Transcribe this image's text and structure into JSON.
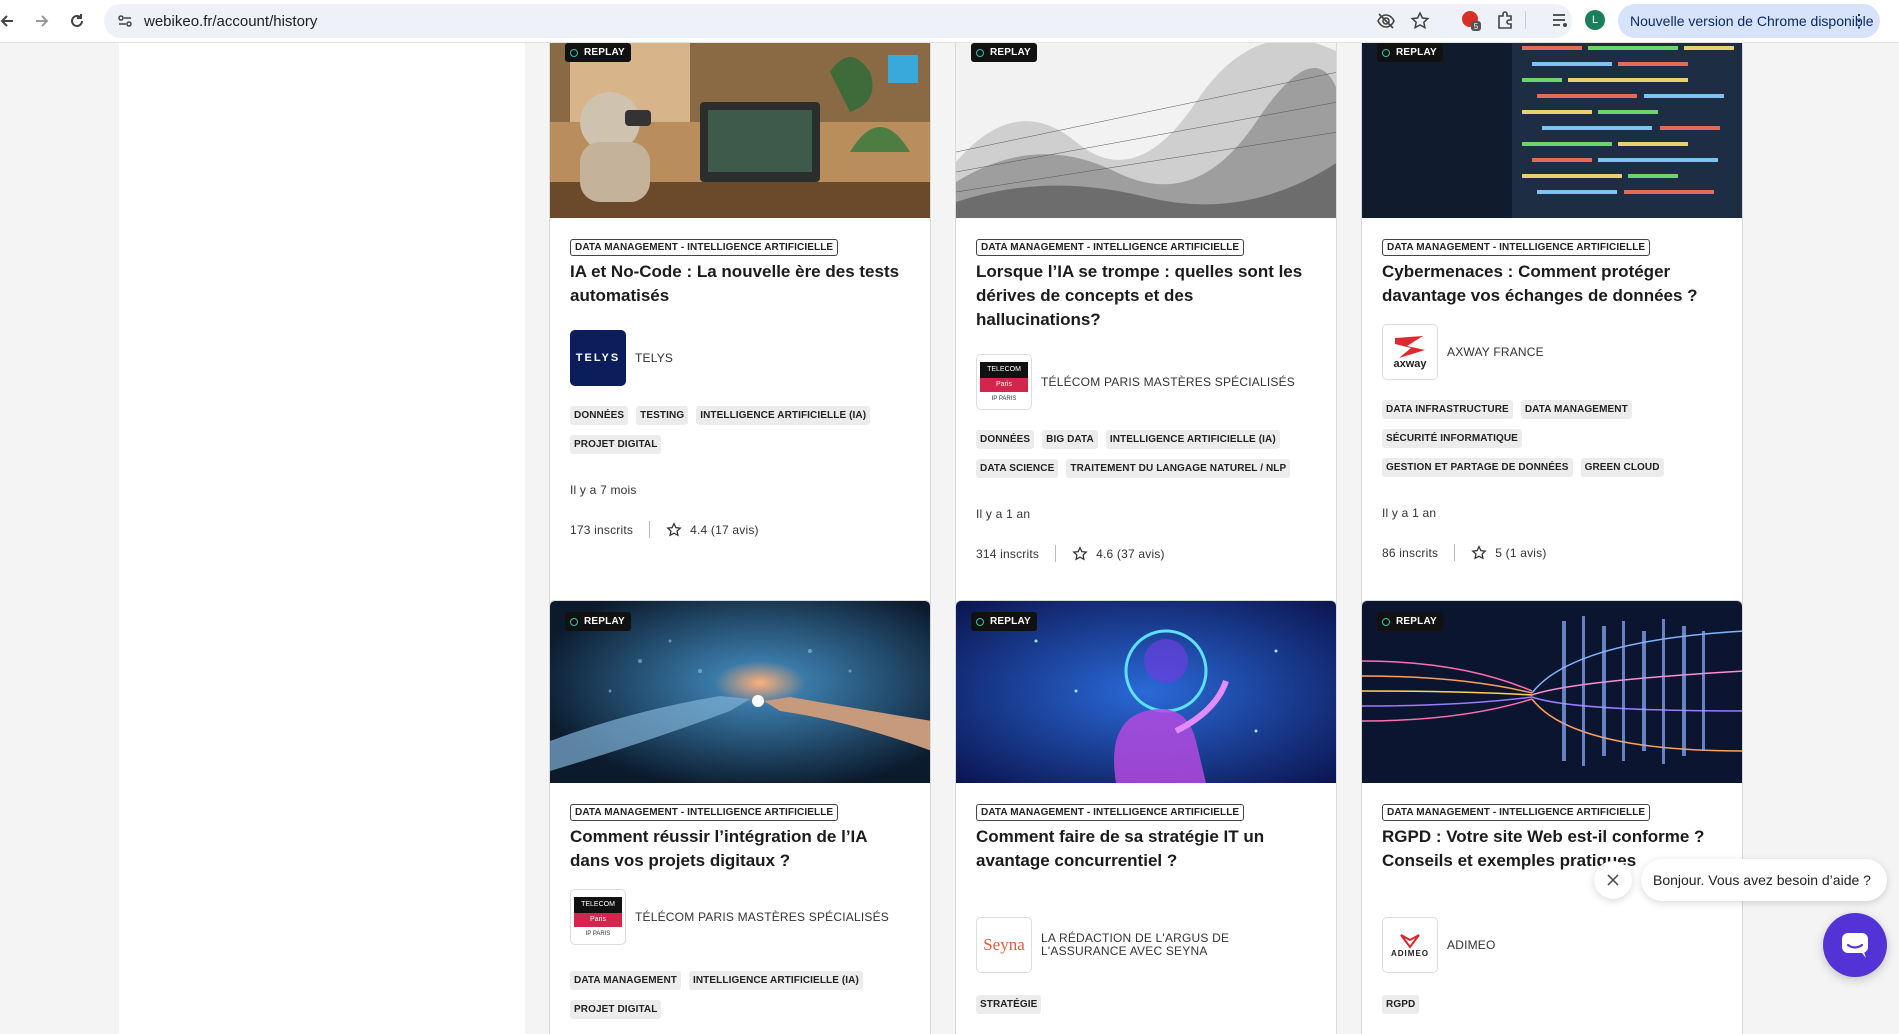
{
  "browser": {
    "url": "webikeo.fr/account/history",
    "update_label": "Nouvelle version de Chrome disponible",
    "profile_initial": "L",
    "extension_badge": "5"
  },
  "cards": [
    {
      "replay": "REPLAY",
      "category": "DATA MANAGEMENT - INTELLIGENCE ARTIFICIELLE",
      "title": "IA et No-Code : La nouvelle ère des tests automatisés",
      "org": "TELYS",
      "tags": [
        "DONNÉES",
        "TESTING",
        "INTELLIGENCE ARTIFICIELLE (IA)",
        "PROJET DIGITAL"
      ],
      "date": "Il y a 7 mois",
      "subscribers": "173 inscrits",
      "rating": "4.4 (17 avis)"
    },
    {
      "replay": "REPLAY",
      "category": "DATA MANAGEMENT - INTELLIGENCE ARTIFICIELLE",
      "title": "Lorsque l’IA se trompe : quelles sont les dérives de concepts et des hallucinations?",
      "org": "TÉLÉCOM PARIS MASTÈRES SPÉCIALISÉS",
      "tags": [
        "DONNÉES",
        "BIG DATA",
        "INTELLIGENCE ARTIFICIELLE (IA)",
        "DATA SCIENCE",
        "TRAITEMENT DU LANGAGE NATUREL / NLP"
      ],
      "date": "Il y a 1 an",
      "subscribers": "314 inscrits",
      "rating": "4.6 (37 avis)"
    },
    {
      "replay": "REPLAY",
      "category": "DATA MANAGEMENT - INTELLIGENCE ARTIFICIELLE",
      "title": "Cybermenaces : Comment protéger davantage vos échanges de données ?",
      "org": "AXWAY FRANCE",
      "tags": [
        "DATA INFRASTRUCTURE",
        "DATA MANAGEMENT",
        "SÉCURITÉ INFORMATIQUE",
        "GESTION ET PARTAGE DE DONNÉES",
        "GREEN CLOUD"
      ],
      "date": "Il y a 1 an",
      "subscribers": "86 inscrits",
      "rating": "5 (1 avis)"
    },
    {
      "replay": "REPLAY",
      "category": "DATA MANAGEMENT - INTELLIGENCE ARTIFICIELLE",
      "title": "Comment réussir l’intégration de l’IA dans vos projets digitaux ?",
      "org": "TÉLÉCOM PARIS MASTÈRES SPÉCIALISÉS",
      "tags": [
        "DATA MANAGEMENT",
        "INTELLIGENCE ARTIFICIELLE (IA)",
        "PROJET DIGITAL"
      ]
    },
    {
      "replay": "REPLAY",
      "category": "DATA MANAGEMENT - INTELLIGENCE ARTIFICIELLE",
      "title": "Comment faire de sa stratégie IT un avantage concurrentiel ?",
      "org": "LA RÉDACTION DE L'ARGUS DE L'ASSURANCE AVEC SEYNA",
      "tags": [
        "STRATÉGIE"
      ]
    },
    {
      "replay": "REPLAY",
      "category": "DATA MANAGEMENT - INTELLIGENCE ARTIFICIELLE",
      "title": "RGPD : Votre site Web est-il conforme ? Conseils et exemples pratiques",
      "org": "ADIMEO",
      "tags": [
        "RGPD"
      ]
    }
  ],
  "logos": {
    "telys": "TELYS",
    "telecom_top": "TELECOM",
    "telecom_paris": "Paris",
    "telecom_ip": "IP PARIS",
    "axway": "axway",
    "seyna": "Seyna",
    "adimeo": "ADIMEO"
  },
  "chat": {
    "message": "Bonjour. Vous avez besoin d’aide ?"
  },
  "colors": {
    "chat_button": "#5433d6",
    "update_pill": "#d6e3fb"
  }
}
